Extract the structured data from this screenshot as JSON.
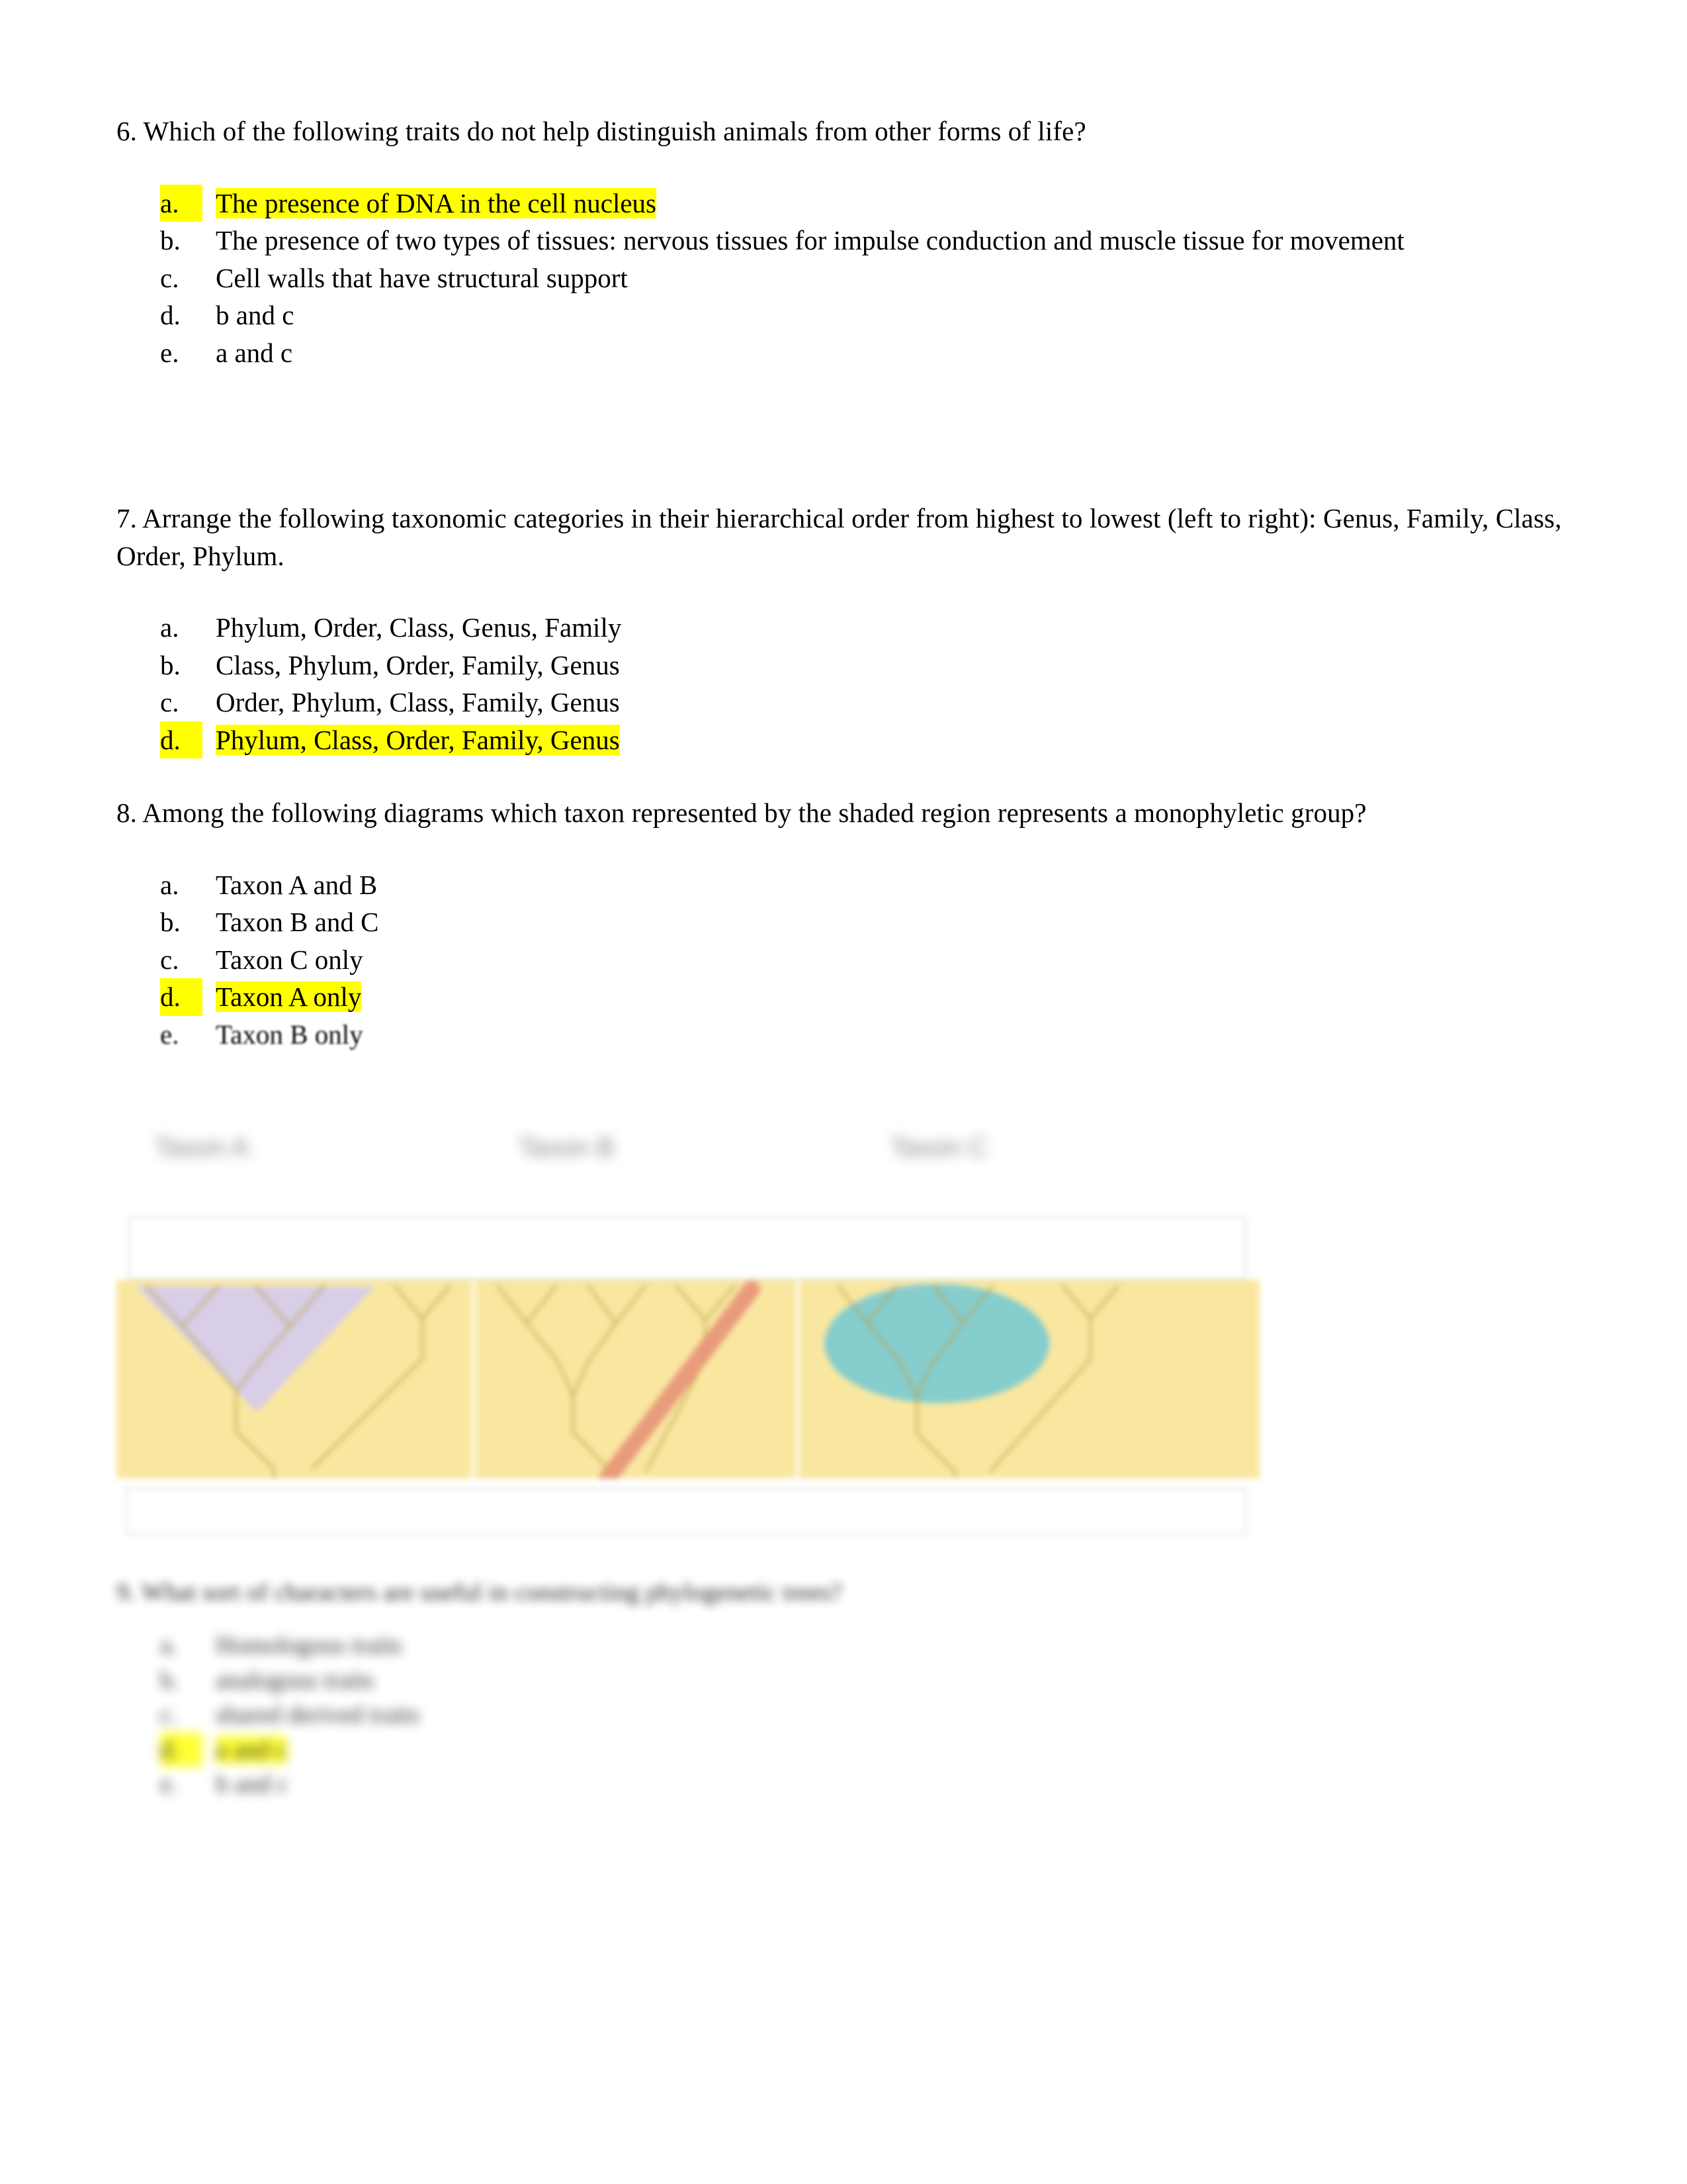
{
  "page": {
    "background_color": "#ffffff",
    "text_color": "#000000",
    "highlight_color": "#FFFF00"
  },
  "questions": [
    {
      "number": "6.",
      "stem": "6. Which of the following traits do not help distinguish animals from other forms of life?",
      "options": [
        {
          "marker": "a.",
          "text": "The presence of DNA in the cell nucleus",
          "highlighted": true
        },
        {
          "marker": "b.",
          "text": "The presence of two types of tissues: nervous tissues for impulse conduction and muscle tissue for movement",
          "highlighted": false
        },
        {
          "marker": "c.",
          "text": "Cell walls that have structural support",
          "highlighted": false
        },
        {
          "marker": "d.",
          "text": "b and c",
          "highlighted": false
        },
        {
          "marker": "e.",
          "text": "a and c",
          "highlighted": false
        }
      ]
    },
    {
      "number": "7.",
      "stem": "7. Arrange the following taxonomic categories in their hierarchical order from highest to lowest (left to right): Genus, Family, Class, Order, Phylum.",
      "options": [
        {
          "marker": "a.",
          "text": "Phylum, Order, Class, Genus, Family",
          "highlighted": false
        },
        {
          "marker": "b.",
          "text": "Class, Phylum, Order, Family, Genus",
          "highlighted": false
        },
        {
          "marker": "c.",
          "text": "Order, Phylum, Class, Family, Genus",
          "highlighted": false
        },
        {
          "marker": "d.",
          "text": "Phylum, Class, Order, Family, Genus",
          "highlighted": true
        }
      ]
    },
    {
      "number": "8.",
      "stem": "8.  Among the following diagrams which taxon represented by the shaded region represents a monophyletic group?",
      "options": [
        {
          "marker": "a.",
          "text": "Taxon A and B",
          "highlighted": false
        },
        {
          "marker": "b.",
          "text": "Taxon B and C",
          "highlighted": false
        },
        {
          "marker": "c.",
          "text": "Taxon C only",
          "highlighted": false
        },
        {
          "marker": "d.",
          "text": "Taxon A only",
          "highlighted": true
        },
        {
          "marker": "e.",
          "text": "Taxon B only",
          "highlighted": false
        }
      ]
    },
    {
      "number": "9.",
      "stem": "9. What sort of characters are useful in constructing phylogenetic trees?",
      "options": [
        {
          "marker": "a.",
          "text": "Homologous traits",
          "highlighted": false
        },
        {
          "marker": "b.",
          "text": "analogous traits",
          "highlighted": false
        },
        {
          "marker": "c.",
          "text": "shared derived traits",
          "highlighted": false
        },
        {
          "marker": "d.",
          "text": "a and c",
          "highlighted": true
        },
        {
          "marker": "e.",
          "text": "b and c",
          "highlighted": false
        }
      ]
    }
  ],
  "figure": {
    "caption_labels": [
      "Taxon A",
      "Taxon B",
      "Taxon C"
    ],
    "background_color": "#F9E7A0",
    "panels": [
      {
        "label": "Taxon A",
        "shade_shape": "triangle-clade",
        "shade_color": "#D6CCEC",
        "shade_description": "purple triangular shading covering a complete clade"
      },
      {
        "label": "Taxon B",
        "shade_shape": "diagonal-band",
        "shade_color": "#E8957A",
        "shade_description": "salmon diagonal band cutting across the tree"
      },
      {
        "label": "Taxon C",
        "shade_shape": "oval",
        "shade_color": "#7FCBD1",
        "shade_description": "teal oval enclosing only terminal tips"
      }
    ]
  }
}
